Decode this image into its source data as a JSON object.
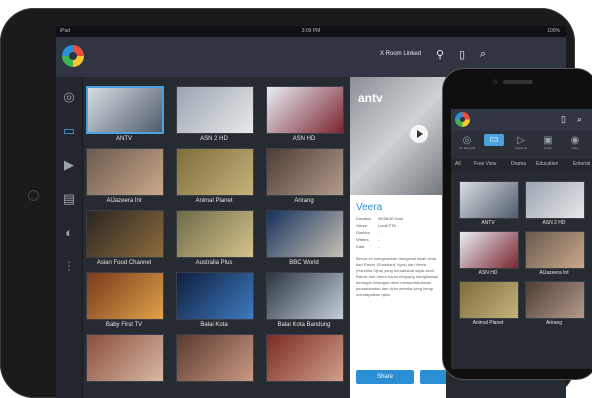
{
  "tablet": {
    "status": {
      "left": "iPad",
      "time": "3:09 PM",
      "right": "100%"
    },
    "room": "X Room Linked",
    "channels": [
      {
        "name": "ANTV",
        "color1": "#d9dde2",
        "color2": "#4f5c6b",
        "selected": true
      },
      {
        "name": "ASN 2 HD",
        "color1": "#9aa4b0",
        "color2": "#e8e9ea",
        "selected": false
      },
      {
        "name": "ASN HD",
        "color1": "#e8eef4",
        "color2": "#7c2430",
        "selected": false
      },
      {
        "name": "AlJazeera Int",
        "color1": "#6b5a4d",
        "color2": "#c9a98c",
        "selected": false
      },
      {
        "name": "Animal Planet",
        "color1": "#7e6c3c",
        "color2": "#c6b27a",
        "selected": false
      },
      {
        "name": "Arirang",
        "color1": "#4d3d35",
        "color2": "#b59b8d",
        "selected": false
      },
      {
        "name": "Asian Food Channel",
        "color1": "#2a2622",
        "color2": "#8c6c3d",
        "selected": false
      },
      {
        "name": "Australia Plus",
        "color1": "#6b6a48",
        "color2": "#d6c38b",
        "selected": false
      },
      {
        "name": "BBC World",
        "color1": "#15315d",
        "color2": "#c8c1b5",
        "selected": false
      },
      {
        "name": "Baby First TV",
        "color1": "#7a3a1c",
        "color2": "#e0a24a",
        "selected": false
      },
      {
        "name": "Balai Kota",
        "color1": "#0f1e3d",
        "color2": "#3e7bc2",
        "selected": false
      },
      {
        "name": "Balai Kota Bandung",
        "color1": "#2c3640",
        "color2": "#c5cfd8",
        "selected": false
      },
      {
        "name": "",
        "color1": "#8a4d3e",
        "color2": "#d8b9a4",
        "selected": false
      },
      {
        "name": "",
        "color1": "#5b3a2e",
        "color2": "#c99984",
        "selected": false
      },
      {
        "name": "",
        "color1": "#7b2a24",
        "color2": "#cfa08a",
        "selected": false
      }
    ],
    "detail": {
      "logo": "antv",
      "title": "Veera",
      "meta": [
        {
          "k": "Duration",
          "v": "09:58:00 Hour"
        },
        {
          "k": "Genre",
          "v": "Local FTA"
        },
        {
          "k": "Director",
          "v": "-"
        },
        {
          "k": "Writers",
          "v": "-"
        },
        {
          "k": "Cast",
          "v": "-"
        }
      ],
      "description": "Berusi ini mengisahkan mengenai kisah cinta dari Ranvir (Shashank Vyas) dan Veera (Harshita Ojha) yang bersahabat sejak kecil. Ranvir dan Veera harus berjuang menghadapi berbagai rintangan demi mempertahankan persahabatan dan cinta mereka yang kerap mendapatkan ujian.",
      "share": "Share"
    }
  },
  "phone": {
    "nav": [
      {
        "icon": "◎",
        "label": "On Demand",
        "active": false
      },
      {
        "icon": "▭",
        "label": "Live TV",
        "active": true
      },
      {
        "icon": "▷",
        "label": "Catch-up",
        "active": false
      },
      {
        "icon": "▣",
        "label": "Guide",
        "active": false
      },
      {
        "icon": "◉",
        "label": "Video",
        "active": false
      }
    ],
    "tabs": [
      "All",
      "Free View",
      "Drama",
      "Education",
      "Entertai"
    ],
    "channels": [
      {
        "name": "ANTV",
        "color1": "#d9dde2",
        "color2": "#4f5c6b"
      },
      {
        "name": "ASN 2 HD",
        "color1": "#9aa4b0",
        "color2": "#e8e9ea"
      },
      {
        "name": "ASN HD",
        "color1": "#e8eef4",
        "color2": "#7c2430"
      },
      {
        "name": "AlJazeera Int",
        "color1": "#6b5a4d",
        "color2": "#c9a98c"
      },
      {
        "name": "Animal Planet",
        "color1": "#7e6c3c",
        "color2": "#c6b27a"
      },
      {
        "name": "Arirang",
        "color1": "#4d3d35",
        "color2": "#b59b8d"
      }
    ]
  }
}
